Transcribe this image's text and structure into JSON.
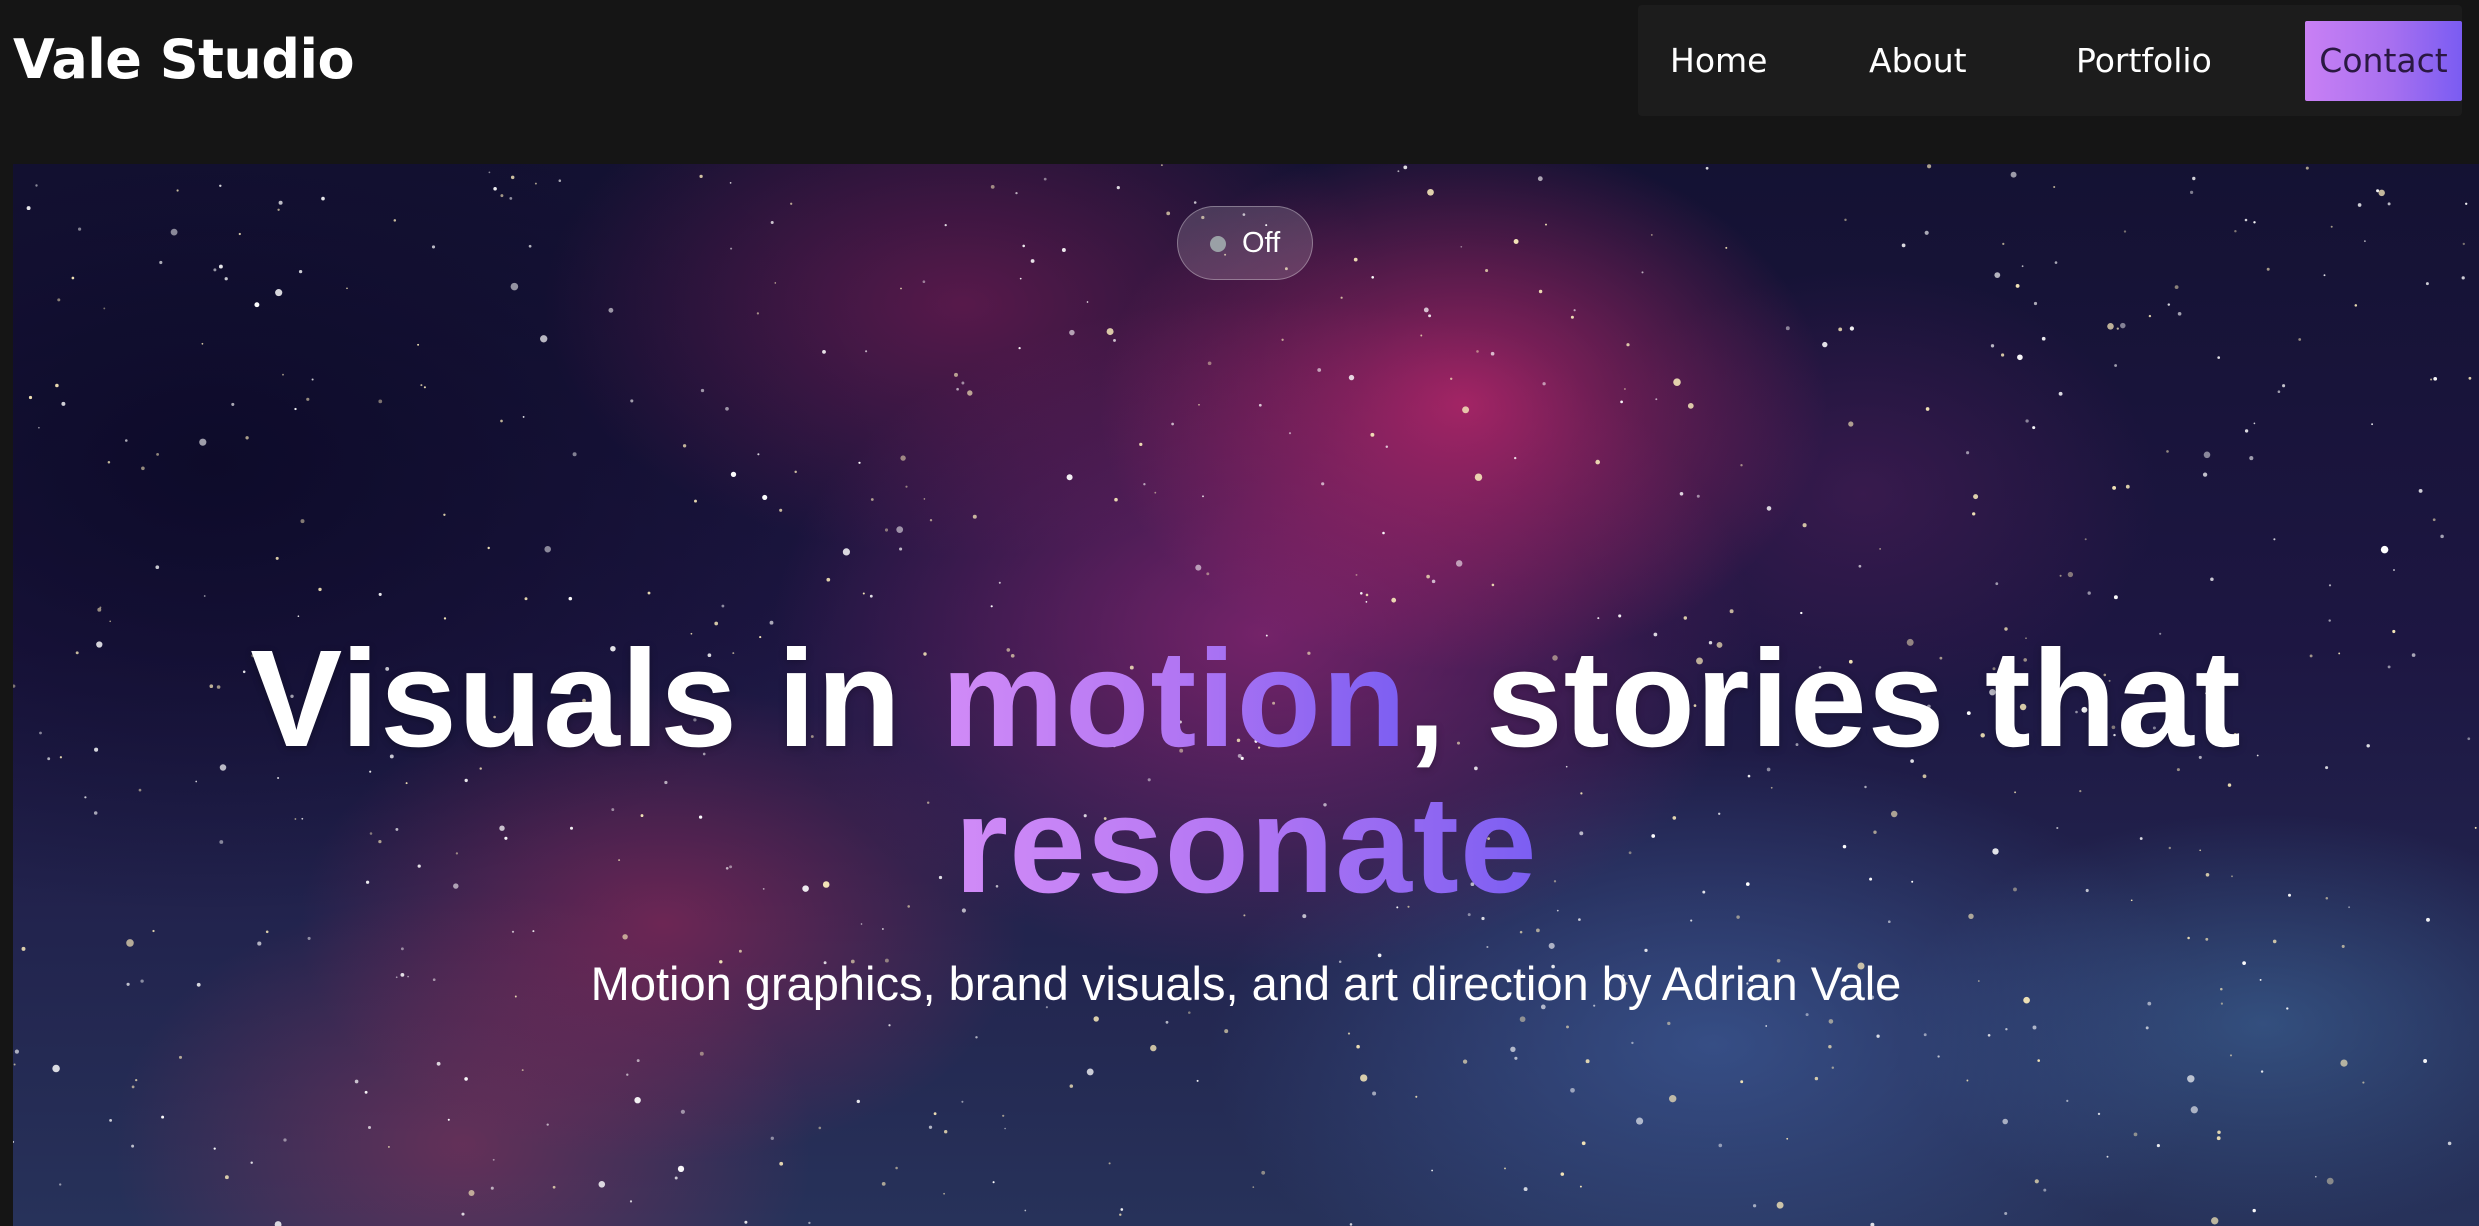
{
  "header": {
    "brand": "Vale Studio",
    "nav": {
      "home": "Home",
      "about": "About",
      "portfolio": "Portfolio",
      "contact": "Contact"
    }
  },
  "hero": {
    "toggle_label": "Off",
    "headline": {
      "part1": "Visuals in ",
      "accent1": "motion",
      "part2": ", stories that",
      "accent2": "resonate"
    },
    "subtitle": "Motion graphics, brand visuals, and art direction by Adrian Vale"
  },
  "colors": {
    "background": "#151515",
    "accent_start": "#d18bf7",
    "accent_end": "#7b5ef2"
  }
}
